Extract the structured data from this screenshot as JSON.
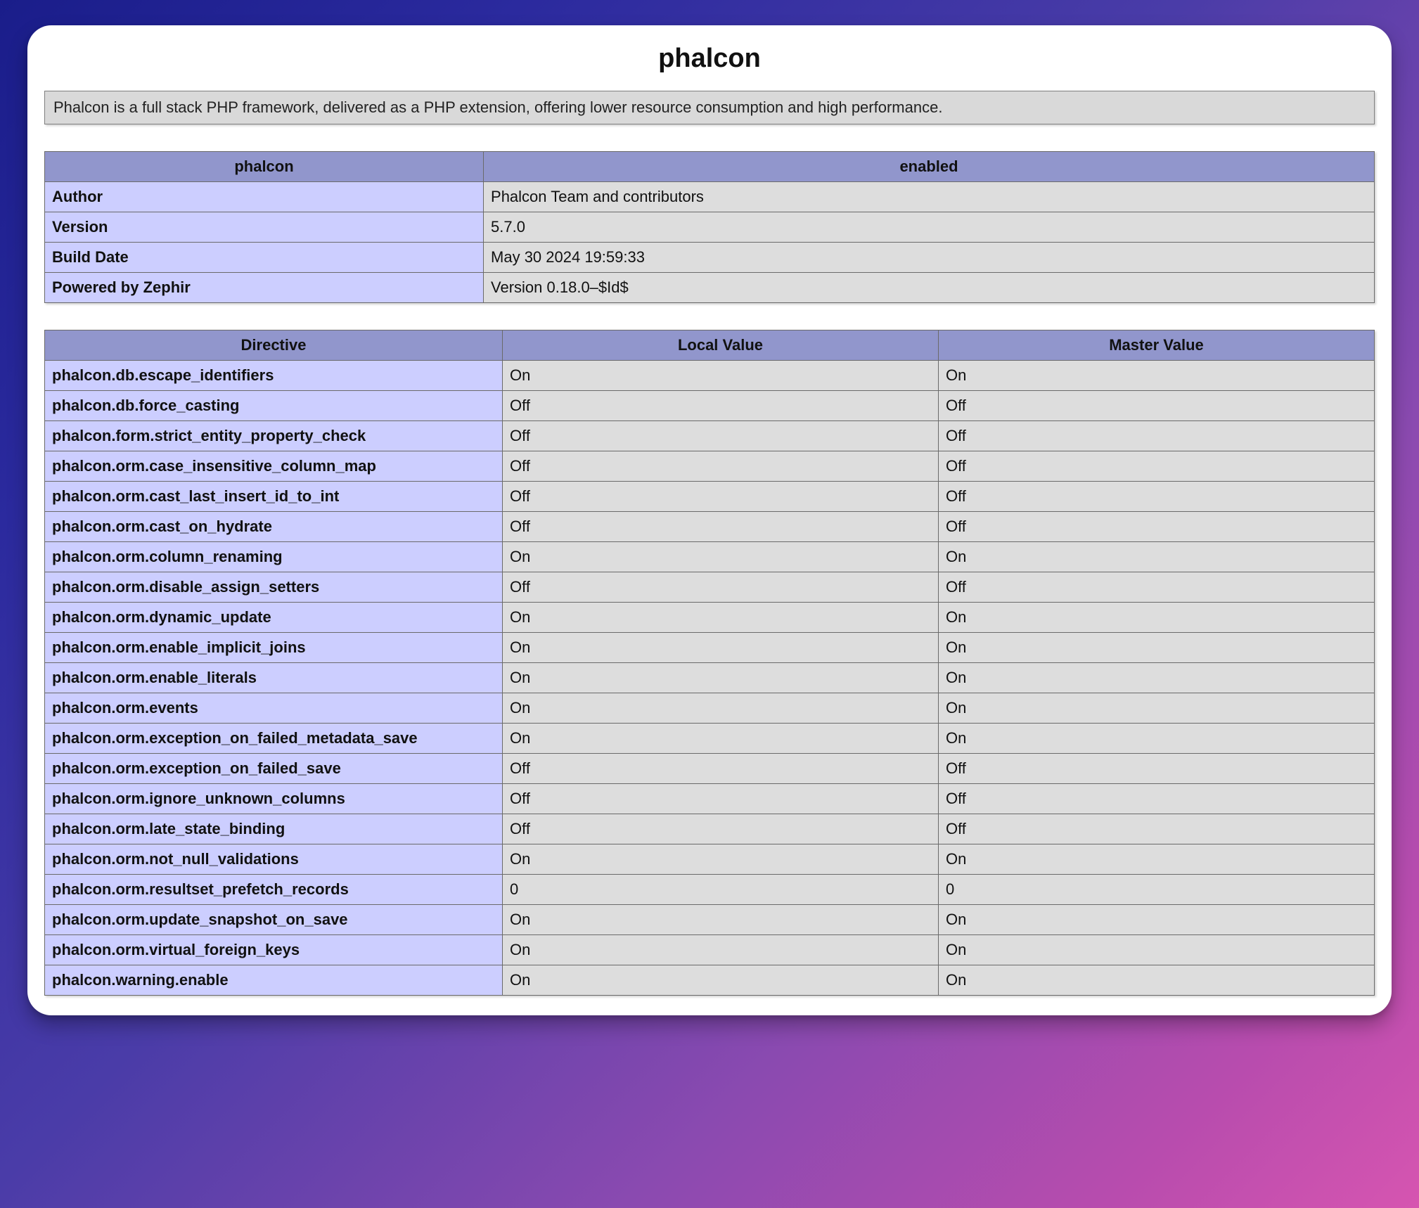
{
  "title": "phalcon",
  "description": "Phalcon is a full stack PHP framework, delivered as a PHP extension, offering lower resource consumption and high performance.",
  "infoHeaders": {
    "left": "phalcon",
    "right": "enabled"
  },
  "infoRows": [
    {
      "k": "Author",
      "v": "Phalcon Team and contributors"
    },
    {
      "k": "Version",
      "v": "5.7.0"
    },
    {
      "k": "Build Date",
      "v": "May 30 2024 19:59:33"
    },
    {
      "k": "Powered by Zephir",
      "v": "Version 0.18.0–$Id$"
    }
  ],
  "dirHeaders": {
    "directive": "Directive",
    "local": "Local Value",
    "master": "Master Value"
  },
  "dirRows": [
    {
      "d": "phalcon.db.escape_identifiers",
      "l": "On",
      "m": "On"
    },
    {
      "d": "phalcon.db.force_casting",
      "l": "Off",
      "m": "Off"
    },
    {
      "d": "phalcon.form.strict_entity_property_check",
      "l": "Off",
      "m": "Off"
    },
    {
      "d": "phalcon.orm.case_insensitive_column_map",
      "l": "Off",
      "m": "Off"
    },
    {
      "d": "phalcon.orm.cast_last_insert_id_to_int",
      "l": "Off",
      "m": "Off"
    },
    {
      "d": "phalcon.orm.cast_on_hydrate",
      "l": "Off",
      "m": "Off"
    },
    {
      "d": "phalcon.orm.column_renaming",
      "l": "On",
      "m": "On"
    },
    {
      "d": "phalcon.orm.disable_assign_setters",
      "l": "Off",
      "m": "Off"
    },
    {
      "d": "phalcon.orm.dynamic_update",
      "l": "On",
      "m": "On"
    },
    {
      "d": "phalcon.orm.enable_implicit_joins",
      "l": "On",
      "m": "On"
    },
    {
      "d": "phalcon.orm.enable_literals",
      "l": "On",
      "m": "On"
    },
    {
      "d": "phalcon.orm.events",
      "l": "On",
      "m": "On"
    },
    {
      "d": "phalcon.orm.exception_on_failed_metadata_save",
      "l": "On",
      "m": "On"
    },
    {
      "d": "phalcon.orm.exception_on_failed_save",
      "l": "Off",
      "m": "Off"
    },
    {
      "d": "phalcon.orm.ignore_unknown_columns",
      "l": "Off",
      "m": "Off"
    },
    {
      "d": "phalcon.orm.late_state_binding",
      "l": "Off",
      "m": "Off"
    },
    {
      "d": "phalcon.orm.not_null_validations",
      "l": "On",
      "m": "On"
    },
    {
      "d": "phalcon.orm.resultset_prefetch_records",
      "l": "0",
      "m": "0"
    },
    {
      "d": "phalcon.orm.update_snapshot_on_save",
      "l": "On",
      "m": "On"
    },
    {
      "d": "phalcon.orm.virtual_foreign_keys",
      "l": "On",
      "m": "On"
    },
    {
      "d": "phalcon.warning.enable",
      "l": "On",
      "m": "On"
    }
  ]
}
